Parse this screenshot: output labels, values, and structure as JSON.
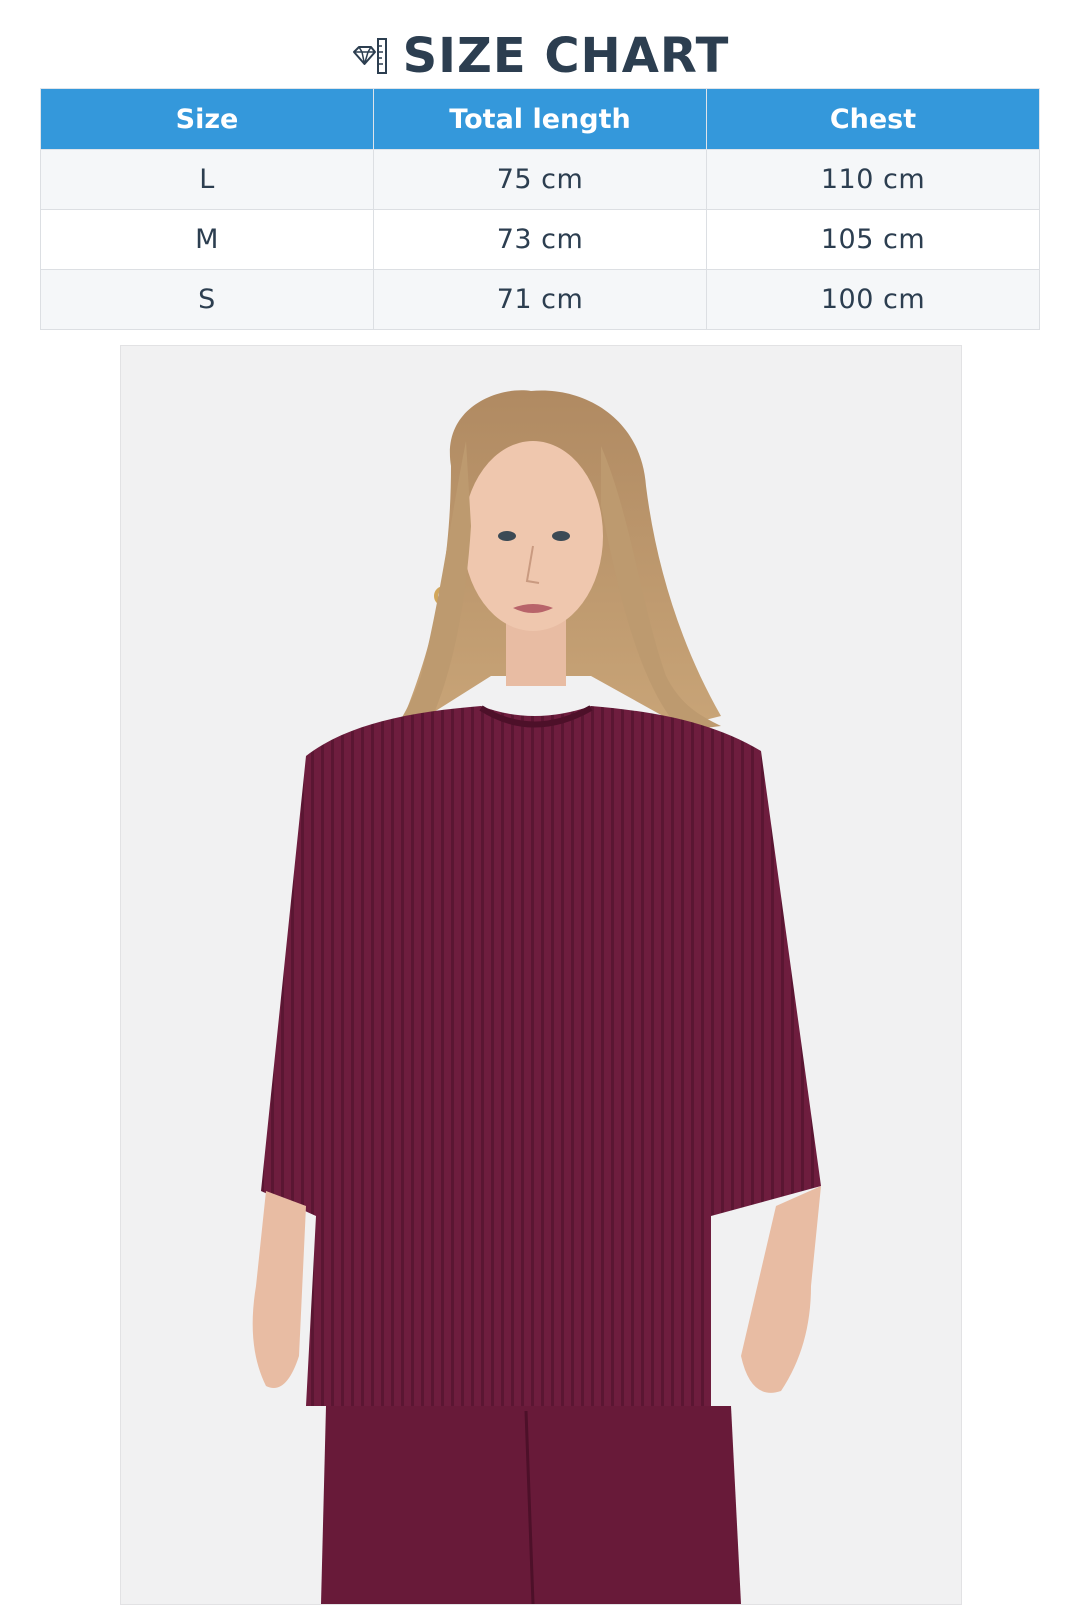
{
  "header": {
    "title": "SIZE CHART",
    "icon": "ruler-diamond-icon"
  },
  "table": {
    "columns": [
      "Size",
      "Total length",
      "Chest"
    ],
    "rows": [
      [
        "L",
        "75 cm",
        "110 cm"
      ],
      [
        "M",
        "73 cm",
        "105 cm"
      ],
      [
        "S",
        "71 cm",
        "100 cm"
      ]
    ]
  },
  "photo": {
    "subject": "model-in-burgundy-ribbed-top",
    "garment_color": "#6e1d3e",
    "background_color": "#f1f1f2"
  },
  "colors": {
    "header_bg": "#3498db",
    "text": "#2c3e50"
  }
}
